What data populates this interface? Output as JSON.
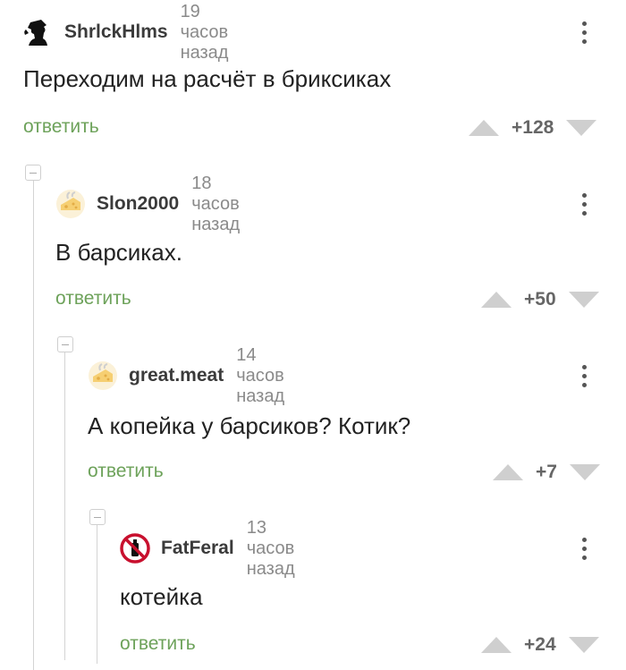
{
  "comments": [
    {
      "author": "ShrlckHlms",
      "time": "19 часов назад",
      "text": "Переходим на расчёт в бриксиках",
      "reply": "ответить",
      "score": "+128",
      "avatar_icon": "sherlock-holmes-icon"
    },
    {
      "author": "Slon2000",
      "time": "18 часов назад",
      "text": "В барсиках.",
      "reply": "ответить",
      "score": "+50",
      "avatar_icon": "cheese-avatar-icon"
    },
    {
      "author": "great.meat",
      "time": "14 часов назад",
      "text": "А копейка у барсиков? Котик?",
      "reply": "ответить",
      "score": "+7",
      "avatar_icon": "cheese-avatar-icon"
    },
    {
      "author": "FatFeral",
      "time": "13 часов назад",
      "text": "котейка",
      "reply": "ответить",
      "score": "+24",
      "avatar_icon": "no-spray-sign-icon"
    }
  ],
  "colors": {
    "reply": "#6da25a",
    "arrow": "#cfcfcf",
    "author": "#3b3b3b",
    "time": "#8a8a8a"
  }
}
